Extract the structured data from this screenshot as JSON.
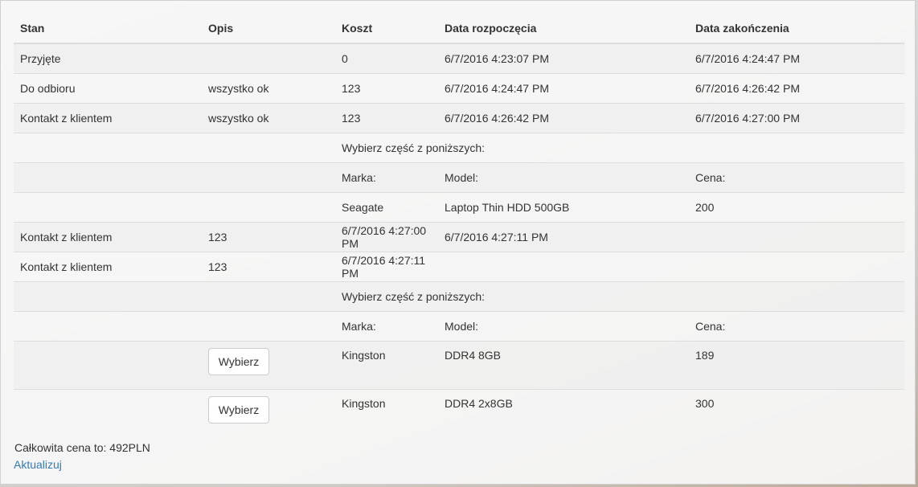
{
  "table": {
    "headers": [
      "Stan",
      "Opis",
      "Koszt",
      "Data rozpoczęcia",
      "Data zakończenia"
    ],
    "rows": [
      {
        "stan": "Przyjęte",
        "opis": "",
        "koszt": "0",
        "start": "6/7/2016 4:23:07 PM",
        "end": "6/7/2016 4:24:47 PM"
      },
      {
        "stan": "Do odbioru",
        "opis": "wszystko ok",
        "koszt": "123",
        "start": "6/7/2016 4:24:47 PM",
        "end": "6/7/2016 4:26:42 PM"
      },
      {
        "stan": "Kontakt z klientem",
        "opis": "wszystko ok",
        "koszt": "123",
        "start": "6/7/2016 4:26:42 PM",
        "end": "6/7/2016 4:27:00 PM"
      },
      {
        "stan": "Kontakt z klientem",
        "opis": "123",
        "koszt": "6/7/2016 4:27:00 PM",
        "start": "6/7/2016 4:27:11 PM",
        "end": ""
      },
      {
        "stan": "Kontakt z klientem",
        "opis": "123",
        "koszt": "6/7/2016 4:27:11 PM",
        "start": "",
        "end": ""
      }
    ],
    "choose_part_label": "Wybierz część z poniższych:",
    "part_headers": {
      "brand": "Marka:",
      "model": "Model:",
      "price": "Cena:"
    },
    "parts_a": [
      {
        "brand": "Seagate",
        "model": "Laptop Thin HDD 500GB",
        "price": "200"
      }
    ],
    "parts_b": [
      {
        "brand": "Kingston",
        "model": "DDR4 8GB",
        "price": "189",
        "button": "Wybierz"
      },
      {
        "brand": "Kingston",
        "model": "DDR4 2x8GB",
        "price": "300",
        "button": "Wybierz"
      }
    ]
  },
  "footer": {
    "total_label": "Całkowita cena to:",
    "total_value": "492",
    "currency": "PLN",
    "refresh_link": "Aktualizuj"
  },
  "colors": {
    "link": "#337ab7",
    "border": "#dddddd"
  }
}
